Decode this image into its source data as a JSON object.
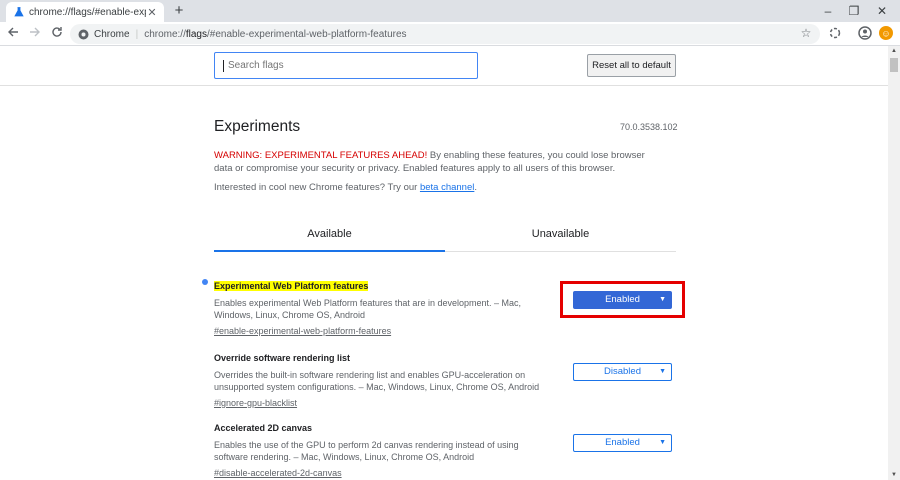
{
  "browser": {
    "tab_title": "chrome://flags/#enable-experim",
    "tab_close": "✕",
    "new_tab": "+",
    "win_min": "–",
    "win_max": "❐",
    "win_close": "✕",
    "omnibox_chip": "Chrome",
    "omnibox_sep": "|",
    "url_prefix": "chrome://",
    "url_host": "flags",
    "url_rest": "/#enable-experimental-web-platform-features",
    "avatar_badge_color": "#f29900"
  },
  "page": {
    "search_placeholder": "Search flags",
    "reset_label": "Reset all to default",
    "title": "Experiments",
    "version": "70.0.3538.102",
    "warning_red": "WARNING: EXPERIMENTAL FEATURES AHEAD!",
    "warning_rest": " By enabling these features, you could lose browser data or compromise your security or privacy. Enabled features apply to all users of this browser.",
    "interested_text": "Interested in cool new Chrome features? Try our ",
    "beta_link": "beta channel",
    "interested_end": ".",
    "tabs": [
      {
        "label": "Available",
        "active": true
      },
      {
        "label": "Unavailable",
        "active": false
      }
    ],
    "flags": [
      {
        "name": "Experimental Web Platform features",
        "desc": "Enables experimental Web Platform features that are in development. – Mac, Windows, Linux, Chrome OS, Android",
        "anchor": "#enable-experimental-web-platform-features",
        "value": "Enabled"
      },
      {
        "name": "Override software rendering list",
        "desc": "Overrides the built-in software rendering list and enables GPU-acceleration on unsupported system configurations. – Mac, Windows, Linux, Chrome OS, Android",
        "anchor": "#ignore-gpu-blacklist",
        "value": "Disabled"
      },
      {
        "name": "Accelerated 2D canvas",
        "desc": "Enables the use of the GPU to perform 2d canvas rendering instead of using software rendering. – Mac, Windows, Linux, Chrome OS, Android",
        "anchor": "#disable-accelerated-2d-canvas",
        "value": "Enabled"
      }
    ],
    "highlight_color": "#e50000"
  },
  "icons": {
    "back": "back-arrow-icon",
    "forward": "forward-arrow-icon",
    "reload": "reload-icon",
    "star": "star-icon",
    "extension": "extension-icon",
    "profile": "profile-icon",
    "search": "search-icon",
    "flask": "flask-icon"
  }
}
